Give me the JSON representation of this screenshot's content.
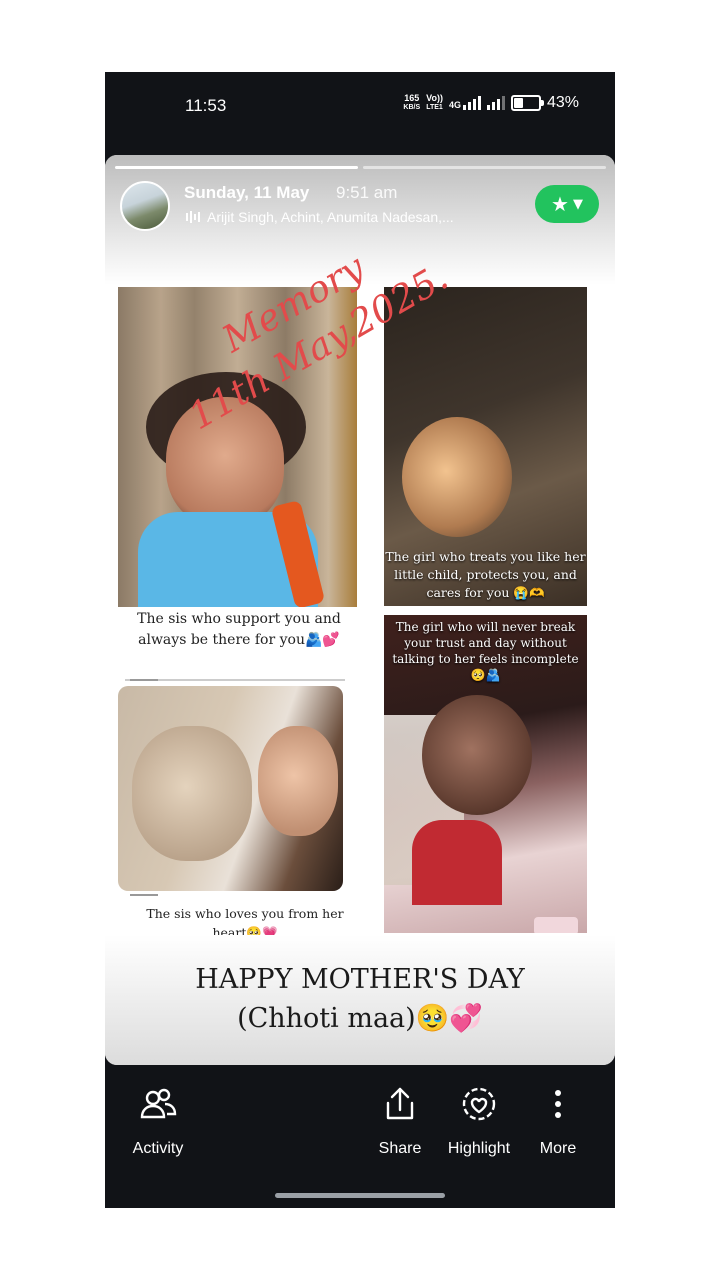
{
  "status_bar": {
    "time": "11:53",
    "net_speed_value": "165",
    "net_speed_unit": "KB/S",
    "volte_top": "Vo))",
    "volte_bottom": "LTE1",
    "net_type": "4G",
    "battery_percent": "43%",
    "battery_level": 0.43
  },
  "story_header": {
    "date": "Sunday, 11 May",
    "time": "9:51 am",
    "music": "Arijit Singh, Achint, Anumita Nadesan,...",
    "favorite_icon": "star-icon",
    "progress_segments": 2
  },
  "overlay_text": {
    "line1": "Memory",
    "line2": "11th May,2025."
  },
  "photos": [
    {
      "caption": "The sis who support you and always be there for you🫂💕"
    },
    {
      "caption": "The girl who treats you like her little child, protects you, and cares for you 😭🫶"
    },
    {
      "caption": "The sis who loves you from her heart🥺💗"
    },
    {
      "caption": "The girl who will never break your trust and day without talking to her feels incomplete 🥺🫂"
    }
  ],
  "banner": {
    "line1": "HAPPY MOTHER'S DAY",
    "line2": "(Chhoti maa)🥹💞"
  },
  "actions": {
    "activity": "Activity",
    "share": "Share",
    "highlight": "Highlight",
    "more": "More"
  },
  "colors": {
    "accent_green": "#22c35e",
    "memory_red": "#e24b4b",
    "bar_bg": "#111317"
  }
}
